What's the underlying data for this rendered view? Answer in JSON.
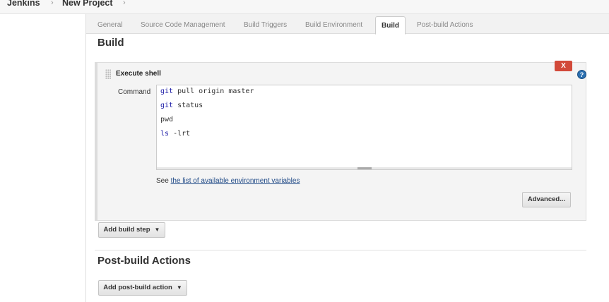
{
  "header": {
    "breadcrumbs": [
      "Jenkins",
      "New Project"
    ]
  },
  "tabs": [
    {
      "label": "General"
    },
    {
      "label": "Source Code Management"
    },
    {
      "label": "Build Triggers"
    },
    {
      "label": "Build Environment"
    },
    {
      "label": "Build",
      "active": true
    },
    {
      "label": "Post-build Actions"
    }
  ],
  "build": {
    "title": "Build",
    "step": {
      "title": "Execute shell",
      "delete_label": "X",
      "help_label": "?",
      "command_label": "Command",
      "command_lines": [
        {
          "kw": "git",
          "rest": " pull origin master"
        },
        {
          "kw": "git",
          "rest": " status"
        },
        {
          "kw": "",
          "rest": "pwd"
        },
        {
          "kw": "ls",
          "rest": " -lrt"
        }
      ],
      "env_prefix": "See ",
      "env_link": "the list of available environment variables",
      "advanced_label": "Advanced..."
    },
    "add_step_label": "Add build step"
  },
  "post_build": {
    "title": "Post-build Actions",
    "add_action_label": "Add post-build action"
  },
  "colors": {
    "accent_link": "#204a87",
    "delete_red": "#d24939",
    "help_blue": "#2a6fb0",
    "shell_keyword": "#1a1aa6"
  }
}
